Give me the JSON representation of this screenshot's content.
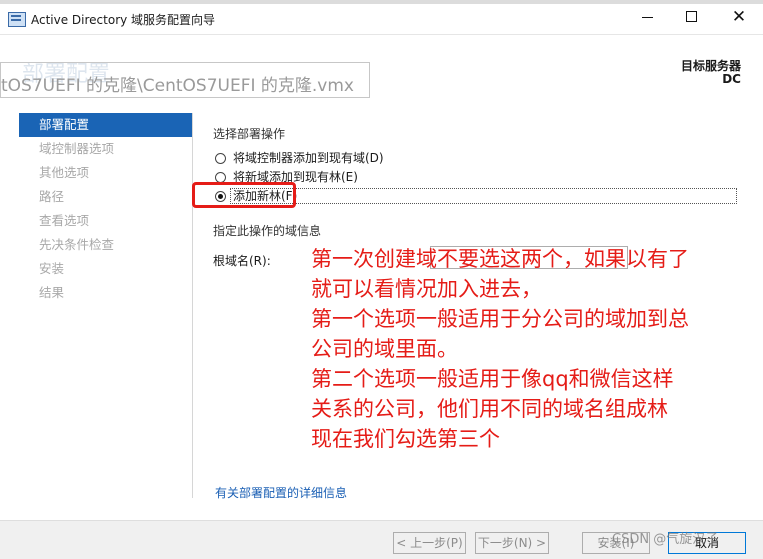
{
  "window": {
    "title": "Active Directory 域服务配置向导",
    "close_glyph": "✕"
  },
  "header": {
    "page_heading": "部署配置",
    "overlay_path": "tOS7UEFI 的克隆\\CentOS7UEFI 的克隆.vmx",
    "target_server_label": "目标服务器",
    "target_server_value": "DC"
  },
  "nav": {
    "items": [
      {
        "label": "部署配置",
        "active": true
      },
      {
        "label": "域控制器选项",
        "active": false
      },
      {
        "label": "其他选项",
        "active": false
      },
      {
        "label": "路径",
        "active": false
      },
      {
        "label": "查看选项",
        "active": false
      },
      {
        "label": "先决条件检查",
        "active": false
      },
      {
        "label": "安装",
        "active": false
      },
      {
        "label": "结果",
        "active": false
      }
    ]
  },
  "deployment": {
    "section_title": "选择部署操作",
    "options": [
      {
        "label": "将域控制器添加到现有域(D)",
        "checked": false
      },
      {
        "label": "将新域添加到现有林(E)",
        "checked": false
      },
      {
        "label": "添加新林(F)",
        "checked": true
      }
    ]
  },
  "domain_info": {
    "title": "指定此操作的域信息",
    "root_domain_label": "根域名(R):",
    "root_domain_value": ""
  },
  "annotation": {
    "lines": [
      "第一次创建域不要选这两个，如果以有了",
      "就可以看情况加入进去，",
      "第一个选项一般适用于分公司的域加到总",
      "公司的域里面。",
      "第二个选项一般适用于像qq和微信这样",
      "关系的公司，他们用不同的域名组成林",
      "现在我们勾选第三个"
    ],
    "color": "#e51c17"
  },
  "details_link": "有关部署配置的详细信息",
  "footer": {
    "prev_label": "< 上一步(P)",
    "next_label": "下一步(N) >",
    "install_label": "安装(I)",
    "cancel_label": "取消"
  },
  "watermark": "CSDN @气旋汉子",
  "colors": {
    "accent": "#1a64b5",
    "heading": "#1b4f8a",
    "highlight": "#e51c17"
  }
}
